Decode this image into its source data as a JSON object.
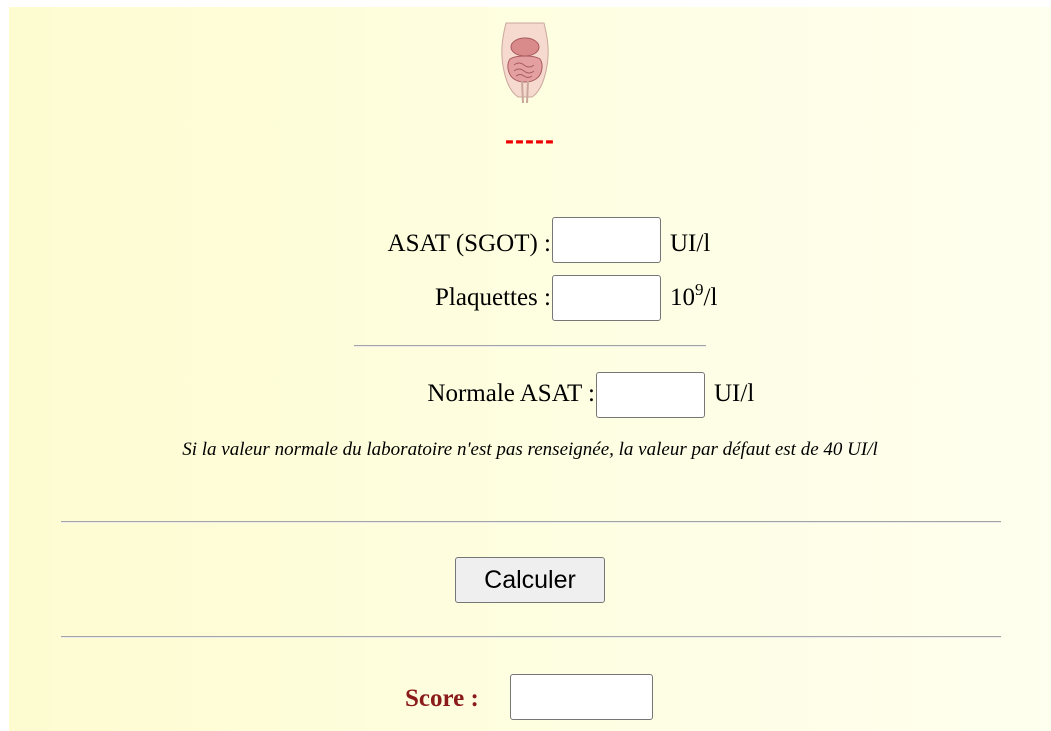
{
  "header": {
    "illustration_icon": "digestive-system-illustration",
    "status_text": "-----",
    "status_color": "#ee0000"
  },
  "form": {
    "asat": {
      "label": "ASAT (SGOT) :",
      "value": "",
      "unit": "UI/l"
    },
    "platelets": {
      "label": "Plaquettes :",
      "value": "",
      "unit_base": "10",
      "unit_exp": "9",
      "unit_suffix": "/l"
    },
    "normal_asat": {
      "label": "Normale ASAT :",
      "value": "",
      "unit": "UI/l"
    },
    "note": "Si la valeur normale du laboratoire n'est pas renseignée, la valeur par défaut est de 40 UI/l"
  },
  "actions": {
    "calculate_label": "Calculer"
  },
  "result": {
    "score_label": "Score :",
    "score_value": "",
    "score_label_color": "#8b1a1a"
  }
}
